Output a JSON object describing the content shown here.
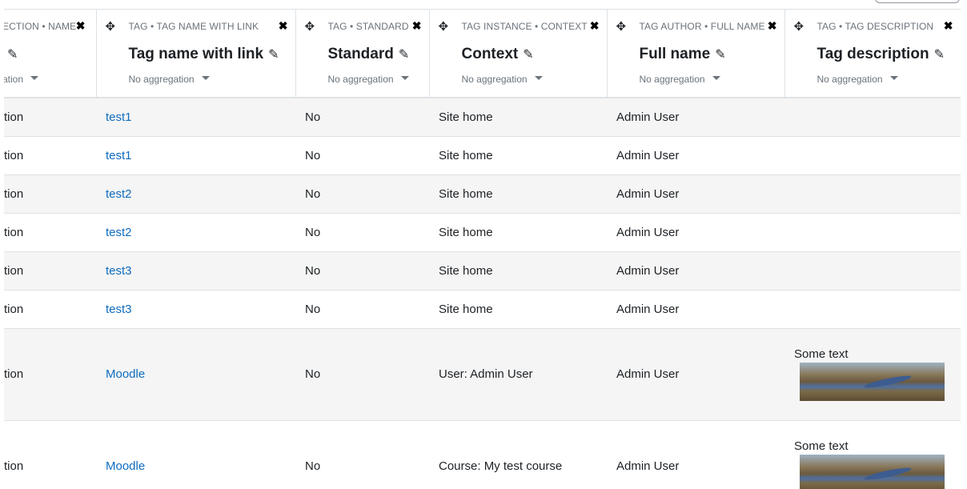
{
  "columns": [
    {
      "category": "ECTION • NAME",
      "title": "",
      "aggregation": "ation"
    },
    {
      "category": "TAG • TAG NAME WITH LINK",
      "title": "Tag name with link",
      "aggregation": "No aggregation"
    },
    {
      "category": "TAG • STANDARD",
      "title": "Standard",
      "aggregation": "No aggregation"
    },
    {
      "category": "TAG INSTANCE • CONTEXT",
      "title": "Context",
      "aggregation": "No aggregation"
    },
    {
      "category": "TAG AUTHOR • FULL NAME",
      "title": "Full name",
      "aggregation": "No aggregation"
    },
    {
      "category": "TAG • TAG DESCRIPTION",
      "title": "Tag description",
      "aggregation": "No aggregation"
    }
  ],
  "rows": [
    {
      "c0": "tion",
      "tag": "test1",
      "standard": "No",
      "context": "Site home",
      "author": "Admin User",
      "desc": ""
    },
    {
      "c0": "tion",
      "tag": "test1",
      "standard": "No",
      "context": "Site home",
      "author": "Admin User",
      "desc": ""
    },
    {
      "c0": "tion",
      "tag": "test2",
      "standard": "No",
      "context": "Site home",
      "author": "Admin User",
      "desc": ""
    },
    {
      "c0": "tion",
      "tag": "test2",
      "standard": "No",
      "context": "Site home",
      "author": "Admin User",
      "desc": ""
    },
    {
      "c0": "tion",
      "tag": "test3",
      "standard": "No",
      "context": "Site home",
      "author": "Admin User",
      "desc": ""
    },
    {
      "c0": "tion",
      "tag": "test3",
      "standard": "No",
      "context": "Site home",
      "author": "Admin User",
      "desc": ""
    },
    {
      "c0": "tion",
      "tag": "Moodle",
      "standard": "No",
      "context": "User: Admin User",
      "author": "Admin User",
      "desc": "Some text"
    },
    {
      "c0": "tion",
      "tag": "Moodle",
      "standard": "No",
      "context": "Course: My test course",
      "author": "Admin User",
      "desc": "Some text"
    }
  ],
  "icons": {
    "move": "arrows-move-icon",
    "close": "close-icon",
    "edit": "pencil-icon",
    "dropdown": "caret-down-icon",
    "image": "landscape-image"
  },
  "colors": {
    "link": "#0f6cbf",
    "muted": "#6a737b",
    "stripe": "#f5f5f5",
    "border": "#dee2e6"
  }
}
